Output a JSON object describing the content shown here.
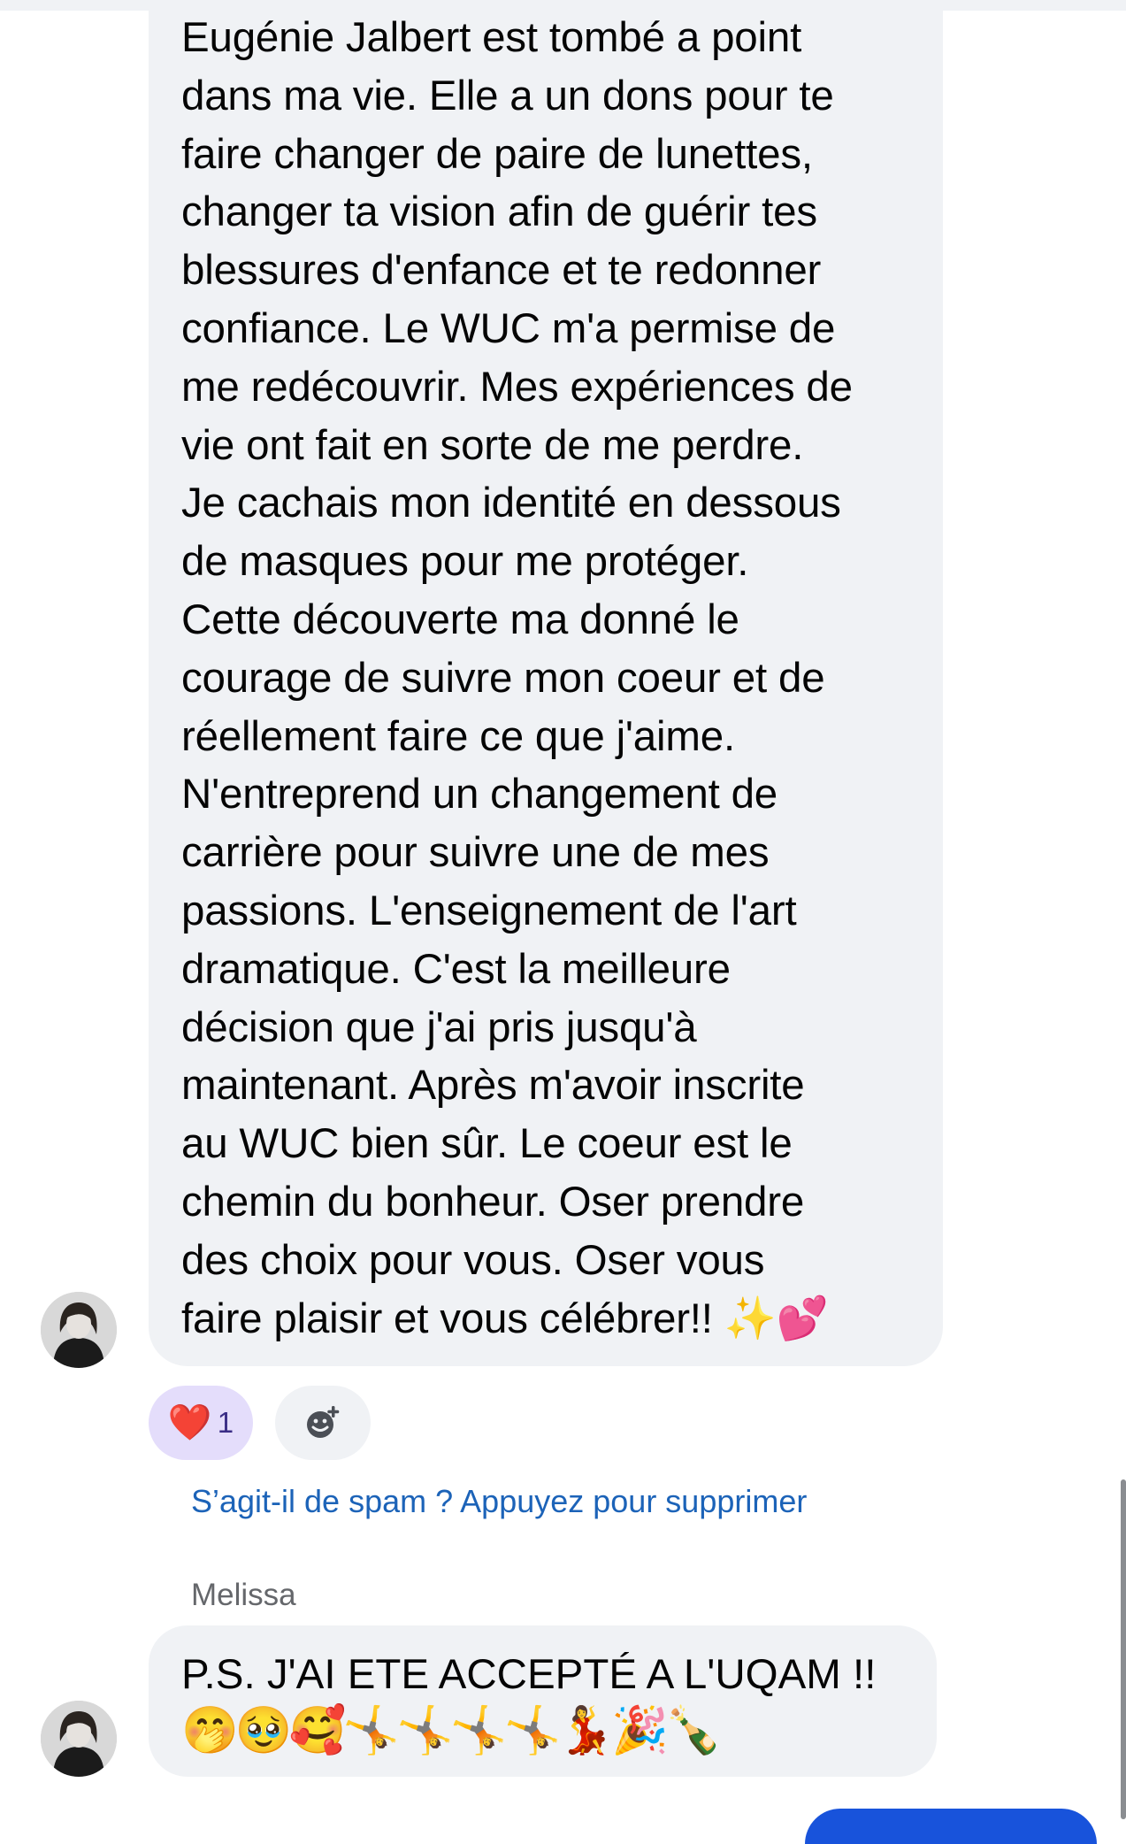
{
  "messages": [
    {
      "text": "Eugénie Jalbert est tombé a point\ndans ma vie. Elle a un dons pour te\nfaire changer de paire de lunettes,\nchanger ta vision afin de guérir tes\nblessures d'enfance et te redonner\nconfiance. Le WUC m'a permise de\nme redécouvrir. Mes expériences de\nvie ont fait en sorte de me perdre.\nJe cachais mon identité en dessous\nde masques pour me protéger.\nCette découverte ma donné le\ncourage de suivre mon coeur et de\nréellement faire ce que j'aime.\nN'entreprend un changement de\ncarrière pour suivre une de mes\npassions. L'enseignement de l'art\ndramatique. C'est la meilleure\ndécision que j'ai pris jusqu'à\nmaintenant. Après m'avoir inscrite\nau WUC bien sûr. Le coeur est le\nchemin du bonheur. Oser prendre\ndes choix pour vous. Oser vous\nfaire plaisir et vous célébrer!! ✨💕",
      "reaction": {
        "emoji": "❤️",
        "count": "1"
      }
    },
    {
      "sender": "Melissa",
      "text": "P.S. J'AI ETE ACCEPTÉ A L'UQAM !!",
      "emojis": "🤭🥹🥰🤸🤸🤸🤸💃🎉🍾"
    }
  ],
  "spam_prompt": "S’agit-il de spam ? Appuyez pour supprimer",
  "icons": {
    "add_reaction": "add-reaction-icon",
    "avatar": "user-avatar"
  },
  "colors": {
    "bubble": "#f0f2f5",
    "reaction_pill": "#e4ddfb",
    "link": "#1c63b8",
    "composer_accent": "#1853db"
  }
}
